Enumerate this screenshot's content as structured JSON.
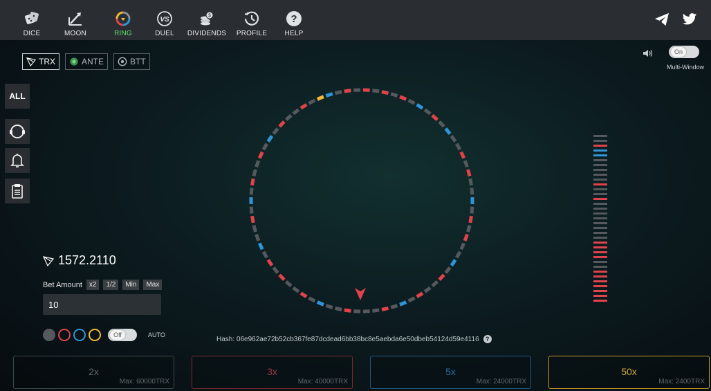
{
  "nav": {
    "items": [
      {
        "label": "DICE",
        "icon": "dice-icon"
      },
      {
        "label": "MOON",
        "icon": "moon-rocket-icon"
      },
      {
        "label": "RING",
        "icon": "ring-icon",
        "active": true
      },
      {
        "label": "DUEL",
        "icon": "vs-icon"
      },
      {
        "label": "DIVIDENDS",
        "icon": "coins-icon"
      },
      {
        "label": "PROFILE",
        "icon": "clock-icon"
      },
      {
        "label": "HELP",
        "icon": "help-icon"
      }
    ],
    "social": [
      "telegram-icon",
      "twitter-icon"
    ]
  },
  "currencies": [
    {
      "label": "TRX",
      "icon": "tron-icon",
      "active": true
    },
    {
      "label": "ANTE",
      "icon": "ante-icon"
    },
    {
      "label": "BTT",
      "icon": "btt-icon"
    }
  ],
  "settings": {
    "multi_window_toggle": "On",
    "multi_window_label": "Multi-Window"
  },
  "sidebar": {
    "all_label": "ALL",
    "icons": [
      "support-icon",
      "bell-icon",
      "clipboard-icon"
    ]
  },
  "balance": "1572.2110",
  "bet": {
    "label": "Bet Amount",
    "x2": "x2",
    "half": "1/2",
    "min": "Min",
    "max": "Max",
    "amount": "10",
    "auto_toggle": "Off",
    "auto_label": "AUTO"
  },
  "colors": {
    "gray": "#55595d",
    "red": "#e1434a",
    "blue": "#2f95d8",
    "yellow": "#f0b83a",
    "accent_green": "#5ee06a"
  },
  "wheel": {
    "segments": [
      "R",
      "G",
      "R",
      "G",
      "R",
      "G",
      "B",
      "G",
      "R",
      "G",
      "B",
      "G",
      "G",
      "R",
      "G",
      "R",
      "G",
      "G",
      "B",
      "G",
      "R",
      "G",
      "R",
      "G",
      "G",
      "B",
      "G",
      "R",
      "G",
      "G",
      "R",
      "G",
      "B",
      "G",
      "R",
      "G",
      "G",
      "G",
      "R",
      "G",
      "G",
      "B",
      "G",
      "R",
      "G",
      "G",
      "R",
      "G",
      "R",
      "G",
      "B",
      "G",
      "G",
      "R",
      "G",
      "B",
      "G",
      "R",
      "G",
      "G",
      "R",
      "G",
      "B",
      "G",
      "R",
      "G",
      "G",
      "R",
      "G",
      "Y",
      "B",
      "G",
      "R",
      "G"
    ]
  },
  "history": [
    "G",
    "G",
    "R",
    "B",
    "B",
    "G",
    "G",
    "G",
    "G",
    "G",
    "R",
    "G",
    "G",
    "R",
    "G",
    "G",
    "G",
    "G",
    "G",
    "G",
    "G",
    "G",
    "R",
    "R",
    "R",
    "R",
    "G",
    "G",
    "R",
    "R",
    "R",
    "R",
    "R",
    "R",
    "R"
  ],
  "hash": "Hash: 06e962ae72b52cb367fe87dcdead6bb38bc8e5aebda6e50dbeb54124d59e4116",
  "bet_panels": [
    {
      "mult": "2x",
      "max": "Max: 60000TRX",
      "color": "#3a4a4e",
      "text_color": "#5f676c"
    },
    {
      "mult": "3x",
      "max": "Max: 40000TRX",
      "color": "#7a2a2e",
      "text_color": "#9a3a3e"
    },
    {
      "mult": "5x",
      "max": "Max: 24000TRX",
      "color": "#1f5b86",
      "text_color": "#2c6fa0"
    },
    {
      "mult": "50x",
      "max": "Max: 2400TRX",
      "color": "#c79a2a",
      "text_color": "#d9aa3a"
    }
  ]
}
